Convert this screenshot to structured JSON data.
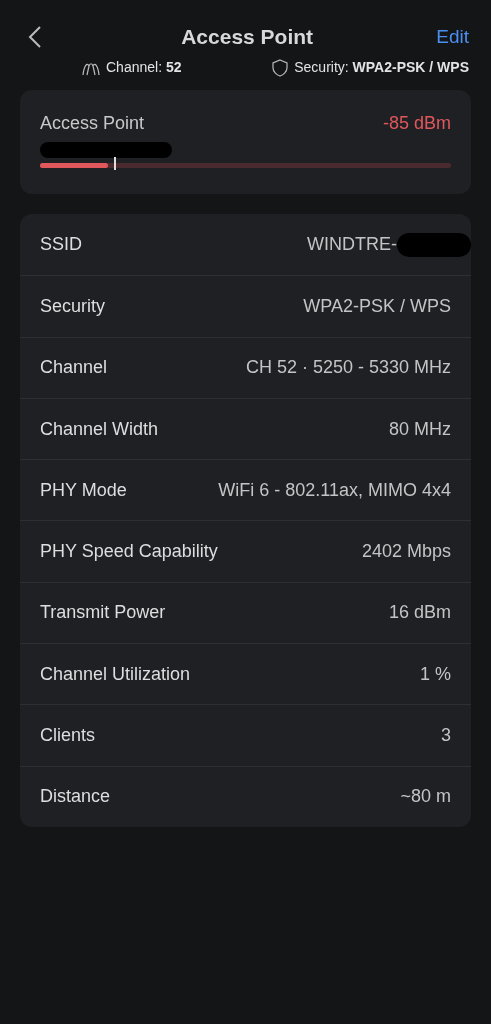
{
  "header": {
    "title": "Access Point",
    "edit": "Edit"
  },
  "info": {
    "channel_label": "Channel:",
    "channel_value": "52",
    "security_label": "Security:",
    "security_value": "WPA2-PSK / WPS"
  },
  "signal": {
    "title": "Access Point",
    "reading": "-85 dBm",
    "level": 0.165
  },
  "details": [
    {
      "label": "SSID",
      "value": "WINDTRE-"
    },
    {
      "label": "Security",
      "value": "WPA2-PSK / WPS"
    },
    {
      "label": "Channel",
      "value": "CH 52 · 5250 - 5330 MHz"
    },
    {
      "label": "Channel Width",
      "value": "80 MHz"
    },
    {
      "label": "PHY Mode",
      "value": "WiFi 6 - 802.11ax, MIMO 4x4"
    },
    {
      "label": "PHY Speed Capability",
      "value": "2402 Mbps"
    },
    {
      "label": "Transmit Power",
      "value": "16 dBm"
    },
    {
      "label": "Channel Utilization",
      "value": "1 %"
    },
    {
      "label": "Clients",
      "value": "3"
    },
    {
      "label": "Distance",
      "value": "~80 m"
    }
  ]
}
